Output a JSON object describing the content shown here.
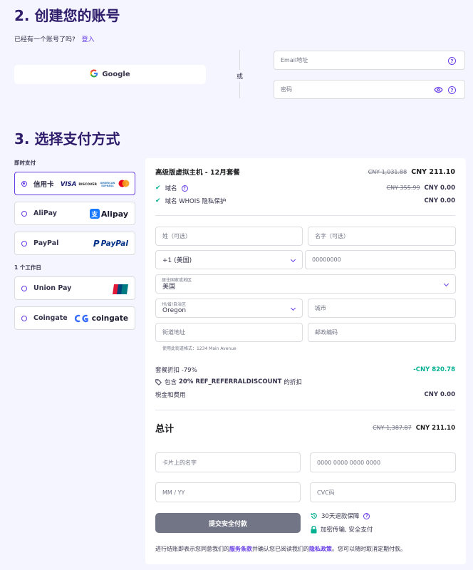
{
  "account": {
    "title": "2. 创建您的账号",
    "have_account": "已经有一个账号了吗?",
    "login_link": "登入",
    "google_label": "Google",
    "or_label": "或",
    "email_placeholder": "Email地址",
    "password_placeholder": "密码"
  },
  "payment": {
    "title": "3. 选择支付方式",
    "instant_label": "即时支付",
    "oneday_label": "1 个工作日",
    "methods": [
      {
        "label": "信用卡",
        "selected": true
      },
      {
        "label": "AliPay"
      },
      {
        "label": "PayPal"
      },
      {
        "label": "Union Pay"
      },
      {
        "label": "Coingate"
      }
    ],
    "logos": {
      "visa": "VISA",
      "discover": "DISCOVER",
      "amex": "AMERICAN EXPRESS",
      "alipay": "Alipay",
      "alipay_char": "支",
      "paypal": "PayPal",
      "unionpay": "UnionPay",
      "coingate": "coingate"
    }
  },
  "summary": {
    "plan_title": "高级版虚拟主机 - 12月套餐",
    "plan_old": "CNY 1,031.88",
    "plan_price": "CNY 211.10",
    "domain_label": "域名",
    "domain_old": "CNY 355.99",
    "domain_price": "CNY 0.00",
    "whois_label": "域名 WHOIS 隐私保护",
    "whois_price": "CNY 0.00",
    "discount_label": "套餐折扣 -79%",
    "discount_value": "-CNY 820.78",
    "coupon_prefix": "包含",
    "coupon_code": "20% REF_REFERRALDISCOUNT",
    "coupon_suffix": "的折扣",
    "tax_label": "税金和费用",
    "tax_value": "CNY 0.00",
    "total_label": "总计",
    "total_old": "CNY 1,387.87",
    "total_price": "CNY 211.10"
  },
  "form": {
    "last_name": "姓（可选）",
    "first_name": "名字（可选）",
    "phone_code": "+1 (美国)",
    "phone_placeholder": "00000000",
    "country_label": "居住国家或地区",
    "country_value": "美国",
    "state_label": "州/省/自治区",
    "state_value": "Oregon",
    "city": "城市",
    "street": "街道地址",
    "zip": "邮政编码",
    "street_hint": "使用此街道格式：1234 Main Avenue",
    "card_name": "卡片上的名字",
    "card_number": "0000 0000 0000 0000",
    "expiry": "MM / YY",
    "cvc": "CVC码",
    "submit": "提交安全付款",
    "guarantee": "30天退款保障",
    "secure": "加密传输, 安全支付",
    "terms_prefix": "进行结账即表示您同意我们的",
    "terms_link": "服务条款",
    "terms_mid": "并确认您已阅读我们的",
    "privacy_link": "隐私政策",
    "terms_suffix": "。您可以随时取消定期付款。"
  },
  "colors": {
    "accent": "#673de6",
    "dark": "#2f1c6a",
    "success": "#00b090",
    "button_disabled": "#727586"
  }
}
